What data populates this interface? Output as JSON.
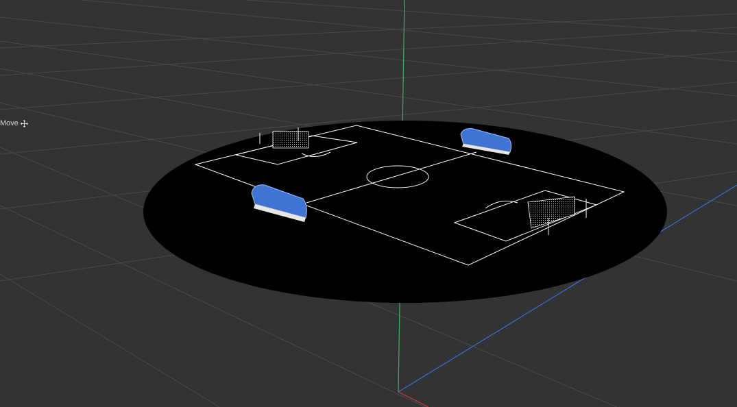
{
  "viewport": {
    "background": "#333333",
    "grid_color": "#4a4a4a",
    "platform_color": "#000000",
    "field_line_color": "#ffffff",
    "axis_colors": {
      "x": "#d03a3a",
      "y": "#3fae5f",
      "z": "#3a6fd8"
    },
    "bench_color": "#3f73d4"
  },
  "tool": {
    "label": "Move",
    "icon": "move-arrows-icon"
  }
}
